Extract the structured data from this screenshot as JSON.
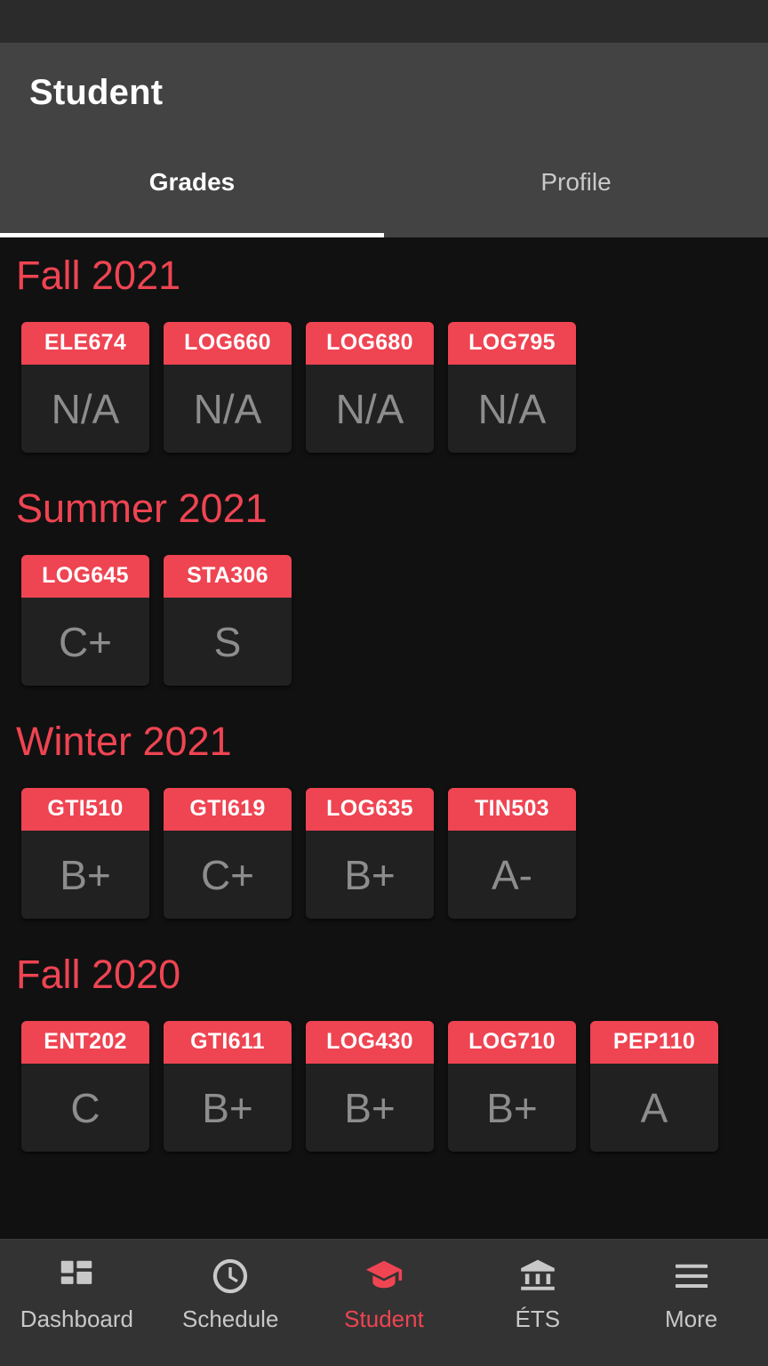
{
  "app": {
    "title": "Student",
    "accent_color": "#ef4452",
    "background_color": "#111111",
    "appbar_color": "#434343",
    "card_body_color": "#212121",
    "grade_text_color": "#8d8d8d"
  },
  "tabs": [
    {
      "label": "Grades",
      "active": true
    },
    {
      "label": "Profile",
      "active": false
    }
  ],
  "terms": [
    {
      "title": "Fall 2021",
      "courses": [
        {
          "code": "ELE674",
          "grade": "N/A"
        },
        {
          "code": "LOG660",
          "grade": "N/A"
        },
        {
          "code": "LOG680",
          "grade": "N/A"
        },
        {
          "code": "LOG795",
          "grade": "N/A"
        }
      ]
    },
    {
      "title": "Summer 2021",
      "courses": [
        {
          "code": "LOG645",
          "grade": "C+"
        },
        {
          "code": "STA306",
          "grade": "S"
        }
      ]
    },
    {
      "title": "Winter 2021",
      "courses": [
        {
          "code": "GTI510",
          "grade": "B+"
        },
        {
          "code": "GTI619",
          "grade": "C+"
        },
        {
          "code": "LOG635",
          "grade": "B+"
        },
        {
          "code": "TIN503",
          "grade": "A-"
        }
      ]
    },
    {
      "title": "Fall 2020",
      "courses": [
        {
          "code": "ENT202",
          "grade": "C"
        },
        {
          "code": "GTI611",
          "grade": "B+"
        },
        {
          "code": "LOG430",
          "grade": "B+"
        },
        {
          "code": "LOG710",
          "grade": "B+"
        },
        {
          "code": "PEP110",
          "grade": "A"
        }
      ]
    }
  ],
  "bottom_nav": [
    {
      "label": "Dashboard",
      "icon": "dashboard-grid-icon",
      "active": false
    },
    {
      "label": "Schedule",
      "icon": "clock-icon",
      "active": false
    },
    {
      "label": "Student",
      "icon": "graduation-cap-icon",
      "active": true
    },
    {
      "label": "ÉTS",
      "icon": "bank-icon",
      "active": false
    },
    {
      "label": "More",
      "icon": "hamburger-menu-icon",
      "active": false
    }
  ]
}
